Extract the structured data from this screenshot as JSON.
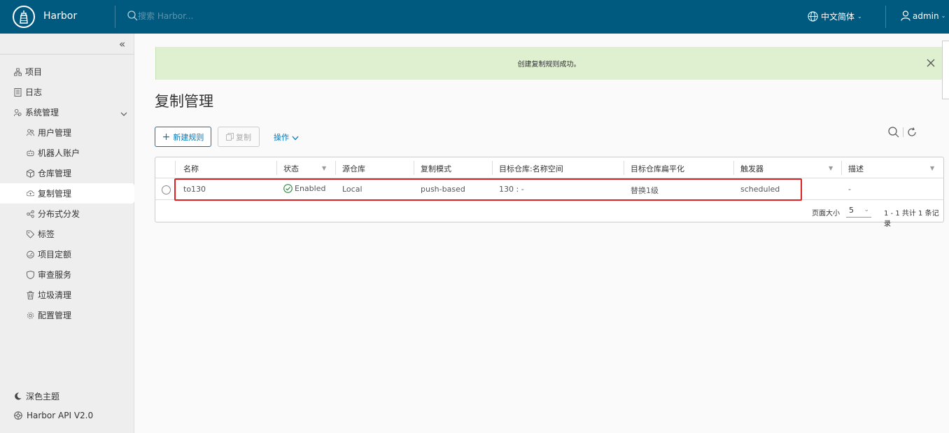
{
  "header": {
    "brand": "Harbor",
    "search_placeholder": "搜索 Harbor...",
    "language": "中文简体",
    "user": "admin"
  },
  "sidebar": {
    "items": [
      {
        "label": "项目",
        "icon": "projects-icon"
      },
      {
        "label": "日志",
        "icon": "logs-icon"
      },
      {
        "label": "系统管理",
        "icon": "admin-icon"
      }
    ],
    "sub_items": [
      {
        "label": "用户管理",
        "icon": "users-icon"
      },
      {
        "label": "机器人账户",
        "icon": "robot-icon"
      },
      {
        "label": "仓库管理",
        "icon": "registry-icon"
      },
      {
        "label": "复制管理",
        "icon": "replication-icon"
      },
      {
        "label": "分布式分发",
        "icon": "distribution-icon"
      },
      {
        "label": "标签",
        "icon": "label-icon"
      },
      {
        "label": "项目定额",
        "icon": "quota-icon"
      },
      {
        "label": "审查服务",
        "icon": "scanner-icon"
      },
      {
        "label": "垃圾清理",
        "icon": "trash-icon"
      },
      {
        "label": "配置管理",
        "icon": "gear-icon"
      }
    ],
    "theme_label": "深色主题",
    "api_label": "Harbor API V2.0"
  },
  "alert": {
    "message": "创建复制规则成功。"
  },
  "page": {
    "title": "复制管理",
    "new_rule_label": "新建规则",
    "copy_label": "复制",
    "actions_label": "操作"
  },
  "table": {
    "columns": [
      "名称",
      "状态",
      "源仓库",
      "复制模式",
      "目标仓库:名称空间",
      "目标仓库扁平化",
      "触发器",
      "描述"
    ],
    "rows": [
      {
        "name": "to130",
        "status": "Enabled",
        "source": "Local",
        "mode": "push-based",
        "dest": "130 : -",
        "flatten": "替换1级",
        "trigger": "scheduled",
        "description": "-"
      }
    ],
    "page_size_label": "页面大小",
    "page_size": "5",
    "page_info": "1 - 1 共计 1 条记录"
  },
  "colors": {
    "header_bg": "#005a80",
    "accent": "#0079b8",
    "success_bg": "#dff0d0",
    "enabled_green": "#2e8540",
    "highlight_red": "#e02020"
  }
}
